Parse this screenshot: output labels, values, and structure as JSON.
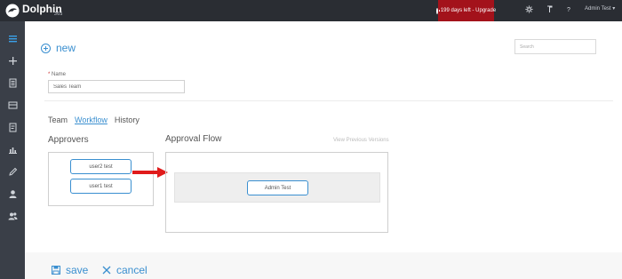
{
  "app": {
    "logo_text": "Dolphin",
    "logo_sub": "365"
  },
  "topbar": {
    "upgrade_text": "199 days left - Upgrade",
    "admin_label": "Admin Test",
    "settings_icon": "gear-icon",
    "pin_icon": "pin-icon",
    "help_label": "?"
  },
  "sidebar": {
    "items": [
      {
        "name": "menu",
        "icon": "hamburger-icon"
      },
      {
        "name": "add",
        "icon": "plus-icon"
      },
      {
        "name": "documents",
        "icon": "document-icon"
      },
      {
        "name": "inbox",
        "icon": "inbox-icon"
      },
      {
        "name": "forms",
        "icon": "form-icon"
      },
      {
        "name": "reports",
        "icon": "bar-chart-icon"
      },
      {
        "name": "edit",
        "icon": "pencil-icon"
      },
      {
        "name": "user",
        "icon": "user-icon"
      },
      {
        "name": "groups",
        "icon": "users-icon"
      }
    ]
  },
  "toolbar": {
    "new_label": "new",
    "search_placeholder": "Search"
  },
  "form": {
    "name_required": "*",
    "name_label": "Name",
    "name_value": "Sales Team"
  },
  "tabs": [
    {
      "label": "Team",
      "active": false
    },
    {
      "label": "Workflow",
      "active": true
    },
    {
      "label": "History",
      "active": false
    }
  ],
  "approvers": {
    "title": "Approvers",
    "users": [
      "user2 test",
      "user1 test"
    ]
  },
  "approval_flow": {
    "title": "Approval Flow",
    "view_previous": "View Previous Versions",
    "steps": [
      "Admin Test"
    ]
  },
  "footer": {
    "save_label": "save",
    "cancel_label": "cancel"
  },
  "colors": {
    "accent": "#3a8fd0",
    "topbar": "#2a2d33",
    "sidebar": "#3a3f48",
    "upgrade": "#a3121b",
    "arrow": "#e01b1b"
  }
}
